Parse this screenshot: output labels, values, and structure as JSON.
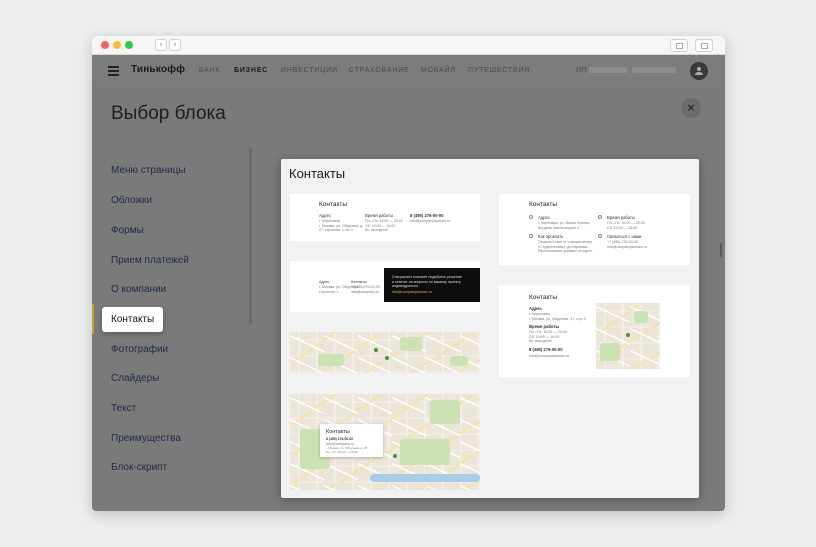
{
  "browser": {
    "back_glyph": "‹",
    "forward_glyph": "›",
    "share_icon": "share-icon",
    "tabs_icon": "tabs-icon"
  },
  "topnav": {
    "brand": "Тинькофф",
    "items": [
      "БАНК",
      "БИЗНЕС",
      "ИНВЕСТИЦИИ",
      "СТРАХОВАНИЕ",
      "МОБАЙЛ",
      "ПУТЕШЕСТВИЯ"
    ],
    "active_item": "БИЗНЕС",
    "account_prefix": "ИП"
  },
  "page": {
    "title": "Выбор блока",
    "close_glyph": "×"
  },
  "sidebar": {
    "items": [
      "Меню страницы",
      "Обложки",
      "Формы",
      "Прием платежей",
      "О компании",
      "Контакты",
      "Фотографии",
      "Слайдеры",
      "Текст",
      "Преимущества",
      "Блок-скрипт"
    ],
    "active_item": "Контакты"
  },
  "panel": {
    "title": "Контакты",
    "card1": {
      "heading": "Контакты",
      "col1_label": "Адрес",
      "col1_text": "г. Череповец\nг. Москва, ул. Обручева, д.\n27, строение 1, кв. 4",
      "col2_label": "Время работы",
      "col2_text": "Пн—Пт: 10:00 — 20:00\nСб: 10:00 — 16:00\nВс: выходной",
      "col3_label": "8 (495) 276-00-00",
      "col3_text": "info@companydomain.ru"
    },
    "card2": {
      "heading": "Контакты",
      "addr_label": "Адрес",
      "addr_text": "г. Черновцы, ул. Ивана Франко,\nБогдана Хмельницкого 3",
      "hours_label": "Время работы",
      "hours_text": "Пн—Пт: 10:00 — 20:00\nСб: 10:00 — 16:00",
      "route_label": "Как проехать",
      "route_text": "Пешком 5 мин от станции метро\n«Студенческая», до парковки.\nРасположение указано на карте.",
      "contact_label": "Связаться с нами",
      "contact_text": "+7 (495) 276-00-00\ninfo@companydomain.ru"
    },
    "card3": {
      "c1_label": "Адрес",
      "c1_text": "г. Москва, ул. Обручева,\nСтроение 1",
      "c2_label": "Контакты",
      "c2_text": "+7(495)276-00-00\ninfo@company.ru",
      "dark_text": "Специалист поможет подобрать решение\nи ответит на вопросы по вашему проекту\nиндивидуально.",
      "dark_link": "info@companydomain.ru"
    },
    "card4": {
      "heading": "Контакты",
      "addr_label": "Адрес",
      "addr_text": "г. Череповец\nг. Москва, ул. Обручева, 37, стр. 4",
      "hours_label": "Время работы",
      "hours_text": "Пн—Пт: 10:00 — 20:00\nСб: 10:00 — 16:00\nВс: выходной",
      "phone": "8 (495) 276-00-00",
      "email": "info@companydomain.ru"
    },
    "card6": {
      "heading": "Контакты",
      "phone": "8 (495) 276-00-00",
      "email": "info@company.ru",
      "text": "г. Москва, ул. Обручева, д. 27\nПн—Пт: 10:00 — 20:00"
    }
  }
}
